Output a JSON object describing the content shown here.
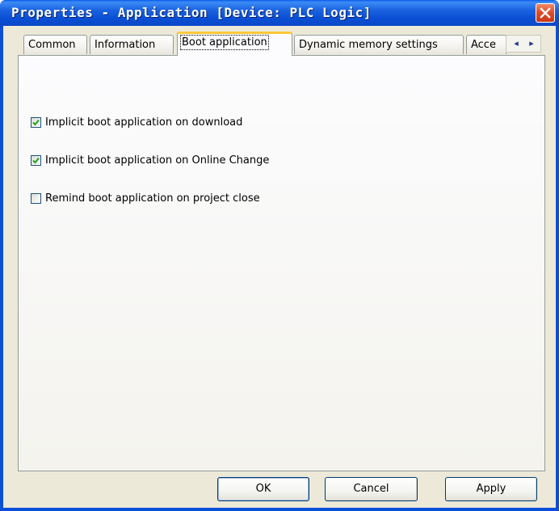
{
  "window": {
    "title": "Properties - Application [Device: PLC Logic]",
    "close_icon": "close-icon"
  },
  "tabs": [
    {
      "label": "Common",
      "active": false
    },
    {
      "label": "Information",
      "active": false
    },
    {
      "label": "Boot application",
      "active": true
    },
    {
      "label": "Dynamic memory settings",
      "active": false
    },
    {
      "label": "Acce",
      "active": false
    }
  ],
  "tab_scroll": {
    "left_icon": "arrow-left-icon",
    "right_icon": "arrow-right-icon",
    "left": "◂",
    "right": "▸"
  },
  "options": [
    {
      "label": "Implicit boot application on download",
      "checked": true
    },
    {
      "label": "Implicit boot application on Online Change",
      "checked": true
    },
    {
      "label": "Remind boot application on project close",
      "checked": false
    }
  ],
  "buttons": {
    "ok": "OK",
    "cancel": "Cancel",
    "apply": "Apply"
  },
  "colors": {
    "title_bar": "#0a4fd4",
    "dialog_bg": "#ece9d8",
    "check_mark": "#21a121",
    "active_tab_accent": "#ffc83c"
  }
}
